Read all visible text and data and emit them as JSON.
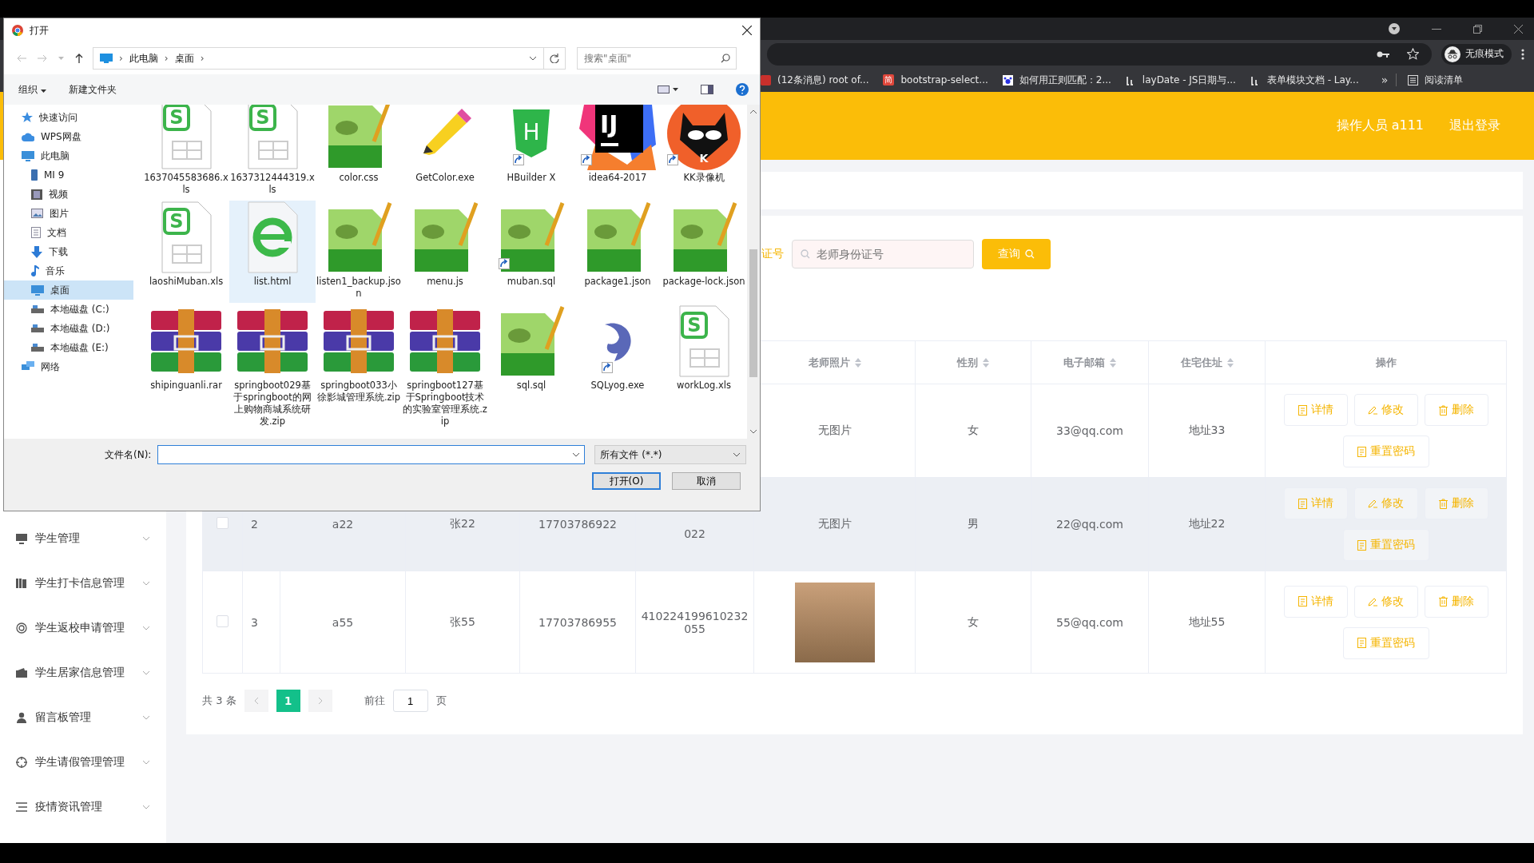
{
  "browser": {
    "incognito": "无痕模式",
    "bookmarks": [
      {
        "label": "(12条消息) root of..."
      },
      {
        "label": "bootstrap-select...",
        "mark": "简"
      },
      {
        "label": "如何用正则匹配：2..."
      },
      {
        "label": "layDate - JS日期与..."
      },
      {
        "label": "表单模块文档 - Lay..."
      }
    ],
    "more": "»",
    "reading_list": "阅读清单"
  },
  "header": {
    "operator": "操作人员 a111",
    "logout": "退出登录"
  },
  "sidebar": {
    "items": [
      {
        "label": "学生管理"
      },
      {
        "label": "学生打卡信息管理"
      },
      {
        "label": "学生返校申请管理"
      },
      {
        "label": "学生居家信息管理"
      },
      {
        "label": "留言板管理"
      },
      {
        "label": "学生请假管理管理"
      },
      {
        "label": "疫情资讯管理"
      }
    ]
  },
  "search": {
    "label": "证号",
    "placeholder": "老师身份证号",
    "button": "查询"
  },
  "table": {
    "columns": [
      {
        "label": "老师照片",
        "sortable": true
      },
      {
        "label": "性别",
        "sortable": true
      },
      {
        "label": "电子邮箱",
        "sortable": true
      },
      {
        "label": "住宅住址",
        "sortable": true
      },
      {
        "label": "操作",
        "sortable": false
      }
    ],
    "rows": [
      {
        "highlighted": false,
        "photo": {
          "kind": "text",
          "text": "无图片"
        },
        "gender": "女",
        "email": "33@qq.com",
        "address": "地址33",
        "actions": [
          {
            "label": "详情",
            "kind": "detail"
          },
          {
            "label": "修改",
            "kind": "edit"
          },
          {
            "label": "删除",
            "kind": "delete"
          },
          {
            "label": "重置密码",
            "kind": "reset"
          }
        ]
      },
      {
        "highlighted": true,
        "checked": false,
        "index": "2",
        "account": "a22",
        "name": "张22",
        "phone": "17703786922",
        "id_card": "022",
        "photo": {
          "kind": "text",
          "text": "无图片"
        },
        "gender": "男",
        "email": "22@qq.com",
        "address": "地址22",
        "actions": [
          {
            "label": "详情",
            "kind": "detail"
          },
          {
            "label": "修改",
            "kind": "edit"
          },
          {
            "label": "删除",
            "kind": "delete"
          },
          {
            "label": "重置密码",
            "kind": "reset"
          }
        ]
      },
      {
        "highlighted": false,
        "checked": false,
        "index": "3",
        "account": "a55",
        "name": "张55",
        "phone": "17703786955",
        "id_card": "410224199610232055",
        "photo": {
          "kind": "image"
        },
        "gender": "女",
        "email": "55@qq.com",
        "address": "地址55",
        "actions": [
          {
            "label": "详情",
            "kind": "detail"
          },
          {
            "label": "修改",
            "kind": "edit"
          },
          {
            "label": "删除",
            "kind": "delete"
          },
          {
            "label": "重置密码",
            "kind": "reset"
          }
        ]
      }
    ]
  },
  "pagination": {
    "total": "共 3 条",
    "pages": [
      {
        "label": "1",
        "selected": true
      }
    ],
    "goto": "前往",
    "page_input": "1",
    "unit": "页"
  },
  "dialog": {
    "title": "打开",
    "path": [
      "此电脑",
      "桌面"
    ],
    "separator": "›",
    "search_placeholder": "搜索\"桌面\"",
    "organize": "组织",
    "new_folder": "新建文件夹",
    "nav": [
      {
        "label": "快速访问",
        "selected": false
      },
      {
        "label": "WPS网盘",
        "selected": false
      },
      {
        "label": "此电脑",
        "selected": false,
        "children": [
          {
            "label": "MI 9",
            "selected": false
          },
          {
            "label": "视频",
            "selected": false
          },
          {
            "label": "图片",
            "selected": false
          },
          {
            "label": "文档",
            "selected": false
          },
          {
            "label": "下载",
            "selected": false
          },
          {
            "label": "音乐",
            "selected": false
          },
          {
            "label": "桌面",
            "selected": true
          },
          {
            "label": "本地磁盘 (C:)",
            "selected": false
          },
          {
            "label": "本地磁盘 (D:)",
            "selected": false
          },
          {
            "label": "本地磁盘 (E:)",
            "selected": false
          }
        ]
      },
      {
        "label": "网络",
        "selected": false
      }
    ],
    "files": [
      {
        "name": "1637045583686.xls",
        "kind": "sheet",
        "mark": "S",
        "shortcut": false,
        "selected": false
      },
      {
        "name": "1637312444319.xls",
        "kind": "sheet",
        "mark": "S",
        "shortcut": false,
        "selected": false
      },
      {
        "name": "color.css",
        "kind": "notepad",
        "shortcut": false,
        "selected": false
      },
      {
        "name": "GetColor.exe",
        "kind": "pencil",
        "shortcut": false,
        "selected": false
      },
      {
        "name": "HBuilder X",
        "kind": "hbuilder",
        "mark": "H",
        "shortcut": true,
        "selected": false
      },
      {
        "name": "idea64-2017",
        "kind": "intellij",
        "mark": "IJ",
        "shortcut": true,
        "selected": false
      },
      {
        "name": "KK录像机",
        "kind": "kk",
        "mark": "K",
        "shortcut": true,
        "selected": false
      },
      {
        "name": "laoshiMuban.xls",
        "kind": "sheet",
        "mark": "S",
        "shortcut": false,
        "selected": false
      },
      {
        "name": "list.html",
        "kind": "ie",
        "shortcut": false,
        "selected": true
      },
      {
        "name": "listen1_backup.json",
        "kind": "notepad",
        "shortcut": false,
        "selected": false
      },
      {
        "name": "menu.js",
        "kind": "notepad",
        "shortcut": false,
        "selected": false
      },
      {
        "name": "muban.sql",
        "kind": "notepad",
        "shortcut": true,
        "selected": false
      },
      {
        "name": "package1.json",
        "kind": "notepad",
        "shortcut": false,
        "selected": false
      },
      {
        "name": "package-lock.json",
        "kind": "notepad",
        "shortcut": false,
        "selected": false
      },
      {
        "name": "shipinguanli.rar",
        "kind": "rar",
        "shortcut": false,
        "selected": false
      },
      {
        "name": "springboot029基于springboot的网上购物商城系统研发.zip",
        "kind": "rar",
        "shortcut": false,
        "selected": false
      },
      {
        "name": "springboot033小徐影城管理系统.zip",
        "kind": "rar",
        "shortcut": false,
        "selected": false
      },
      {
        "name": "springboot127基于Springboot技术的实验室管理系统.zip",
        "kind": "rar",
        "shortcut": false,
        "selected": false
      },
      {
        "name": "sql.sql",
        "kind": "notepad",
        "shortcut": false,
        "selected": false
      },
      {
        "name": "SQLyog.exe",
        "kind": "dolphin",
        "shortcut": true,
        "selected": false
      },
      {
        "name": "workLog.xls",
        "kind": "sheet",
        "mark": "S",
        "shortcut": false,
        "selected": false
      }
    ],
    "filename_label": "文件名(N):",
    "filetype": "所有文件 (*.*)",
    "open": "打开(O)",
    "cancel": "取消"
  }
}
